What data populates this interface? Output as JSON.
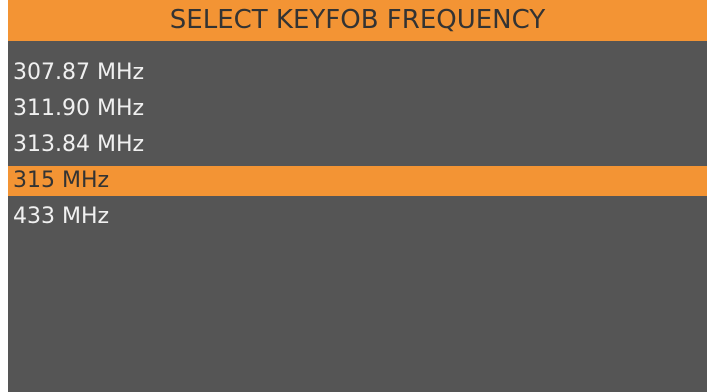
{
  "header": {
    "title": "SELECT KEYFOB FREQUENCY"
  },
  "frequencies": [
    {
      "label": "307.87 MHz",
      "selected": false
    },
    {
      "label": "311.90 MHz",
      "selected": false
    },
    {
      "label": "313.84 MHz",
      "selected": false
    },
    {
      "label": "315 MHz",
      "selected": true
    },
    {
      "label": "433 MHz",
      "selected": false
    }
  ],
  "colors": {
    "accent": "#f39434",
    "background": "#555555",
    "text": "#f0f0f0",
    "selected_text": "#333333"
  }
}
